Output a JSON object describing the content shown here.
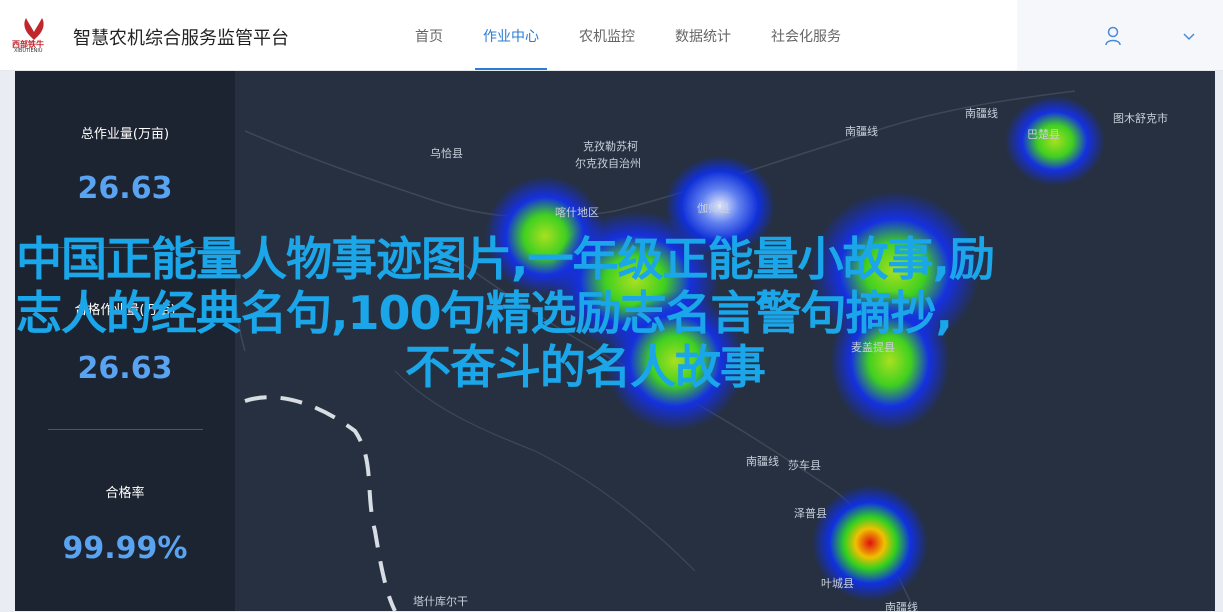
{
  "brand": {
    "logo_text": "西部铁牛",
    "logo_sub": "XIBUTIENIU",
    "color": "#c0272d"
  },
  "app_title": "智慧农机综合服务监管平台",
  "nav": [
    {
      "label": "首页",
      "active": false
    },
    {
      "label": "作业中心",
      "active": true
    },
    {
      "label": "农机监控",
      "active": false
    },
    {
      "label": "数据统计",
      "active": false
    },
    {
      "label": "社会化服务",
      "active": false
    }
  ],
  "stats": [
    {
      "label": "总作业量(万亩)",
      "value": "26.63"
    },
    {
      "label": "合格作业量(万亩)",
      "value": "26.63"
    },
    {
      "label": "合格率",
      "value": "99.99%"
    }
  ],
  "places": [
    "乌恰县",
    "克孜勒苏柯",
    "尔克孜自治州",
    "喀什地区",
    "伽师县",
    "南疆线",
    "南疆线",
    "图木舒克市",
    "巴楚县",
    "麦盖提县",
    "南疆线",
    "莎车县",
    "泽普县",
    "叶城县",
    "塔什库尔干",
    "南疆线"
  ],
  "overlay": {
    "line1": "中国正能量人物事迹图片,一年级正能量小故事,励",
    "line2": "志人的经典名句,100句精选励志名言警句摘抄,",
    "line3": "不奋斗的名人故事"
  },
  "colors": {
    "accent": "#2b7cd3",
    "stat_value": "#59a3f0",
    "overlay_text": "#1aa6e8",
    "map_bg": "#263041"
  },
  "icons": {
    "user": "user-icon",
    "chevron": "chevron-down-icon"
  }
}
